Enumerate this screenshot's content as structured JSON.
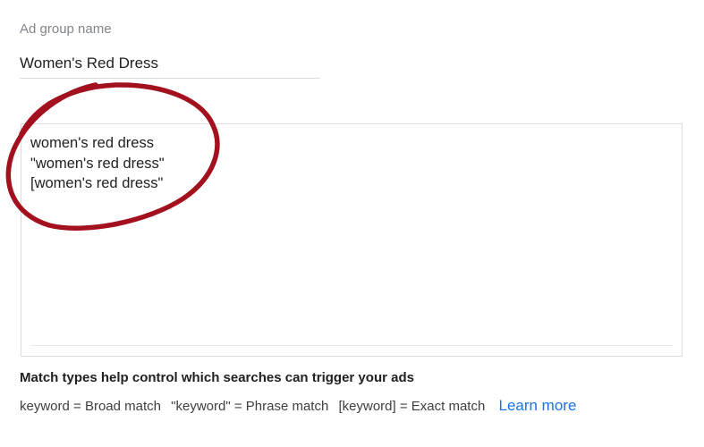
{
  "ad_group": {
    "label": "Ad group name",
    "value": "Women's Red Dress"
  },
  "keywords": {
    "text": "women's red dress\n\"women's red dress\"\n[women's red dress\"",
    "annotation_color": "#a3111f"
  },
  "help": {
    "title": "Match types help control which searches can trigger your ads",
    "broad": "keyword = Broad match",
    "phrase": "\"keyword\" = Phrase match",
    "exact": "[keyword] = Exact match",
    "learn_more": "Learn more",
    "link_color": "#1a73e8"
  }
}
